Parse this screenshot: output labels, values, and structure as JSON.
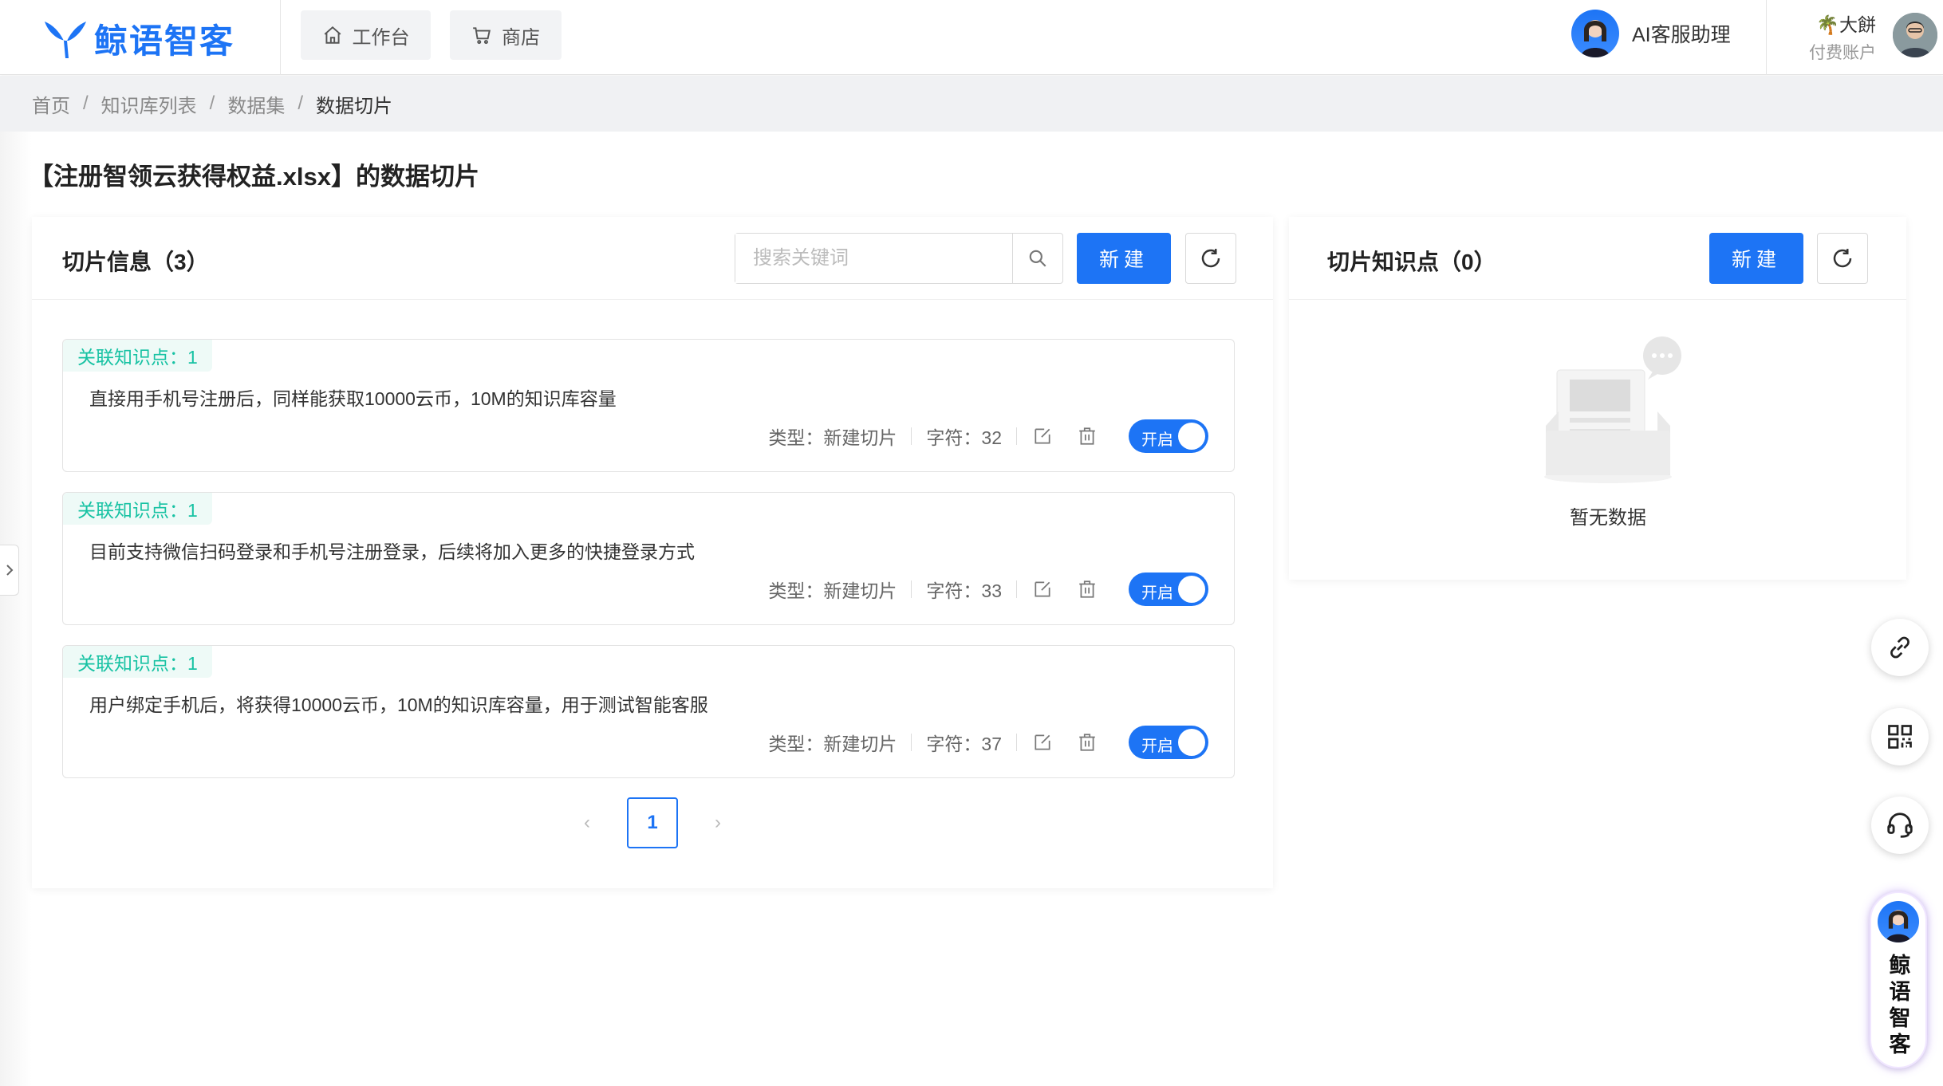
{
  "header": {
    "brand": "鲸语智客",
    "nav": [
      {
        "label": "工作台",
        "icon": "home-icon"
      },
      {
        "label": "商店",
        "icon": "cart-icon"
      }
    ],
    "assistant_label": "AI客服助理",
    "user_name": "🌴大餅",
    "user_account": "付费账户"
  },
  "breadcrumb": [
    "首页",
    "知识库列表",
    "数据集",
    "数据切片"
  ],
  "page_title": "【注册智领云获得权益.xlsx】的数据切片",
  "slices_panel": {
    "title": "切片信息（3）",
    "search_placeholder": "搜索关键词",
    "new_label": "新建",
    "items": [
      {
        "tag": "关联知识点：1",
        "text": "直接用手机号注册后，同样能获取10000云币，10M的知识库容量",
        "type": "类型：新建切片",
        "chars": "字符：32",
        "toggle": "开启"
      },
      {
        "tag": "关联知识点：1",
        "text": "目前支持微信扫码登录和手机号注册登录，后续将加入更多的快捷登录方式",
        "type": "类型：新建切片",
        "chars": "字符：33",
        "toggle": "开启"
      },
      {
        "tag": "关联知识点：1",
        "text": "用户绑定手机后，将获得10000云币，10M的知识库容量，用于测试智能客服",
        "type": "类型：新建切片",
        "chars": "字符：37",
        "toggle": "开启"
      }
    ],
    "pagination": {
      "current": "1",
      "prev": "‹",
      "next": "›"
    }
  },
  "knowledge_panel": {
    "title": "切片知识点（0）",
    "new_label": "新建",
    "empty_text": "暂无数据"
  },
  "float": {
    "brand_vertical": "鲸语智客"
  },
  "colors": {
    "primary": "#1d74f5",
    "tag_text": "#17c2a3",
    "tag_bg": "#eefaf7"
  }
}
